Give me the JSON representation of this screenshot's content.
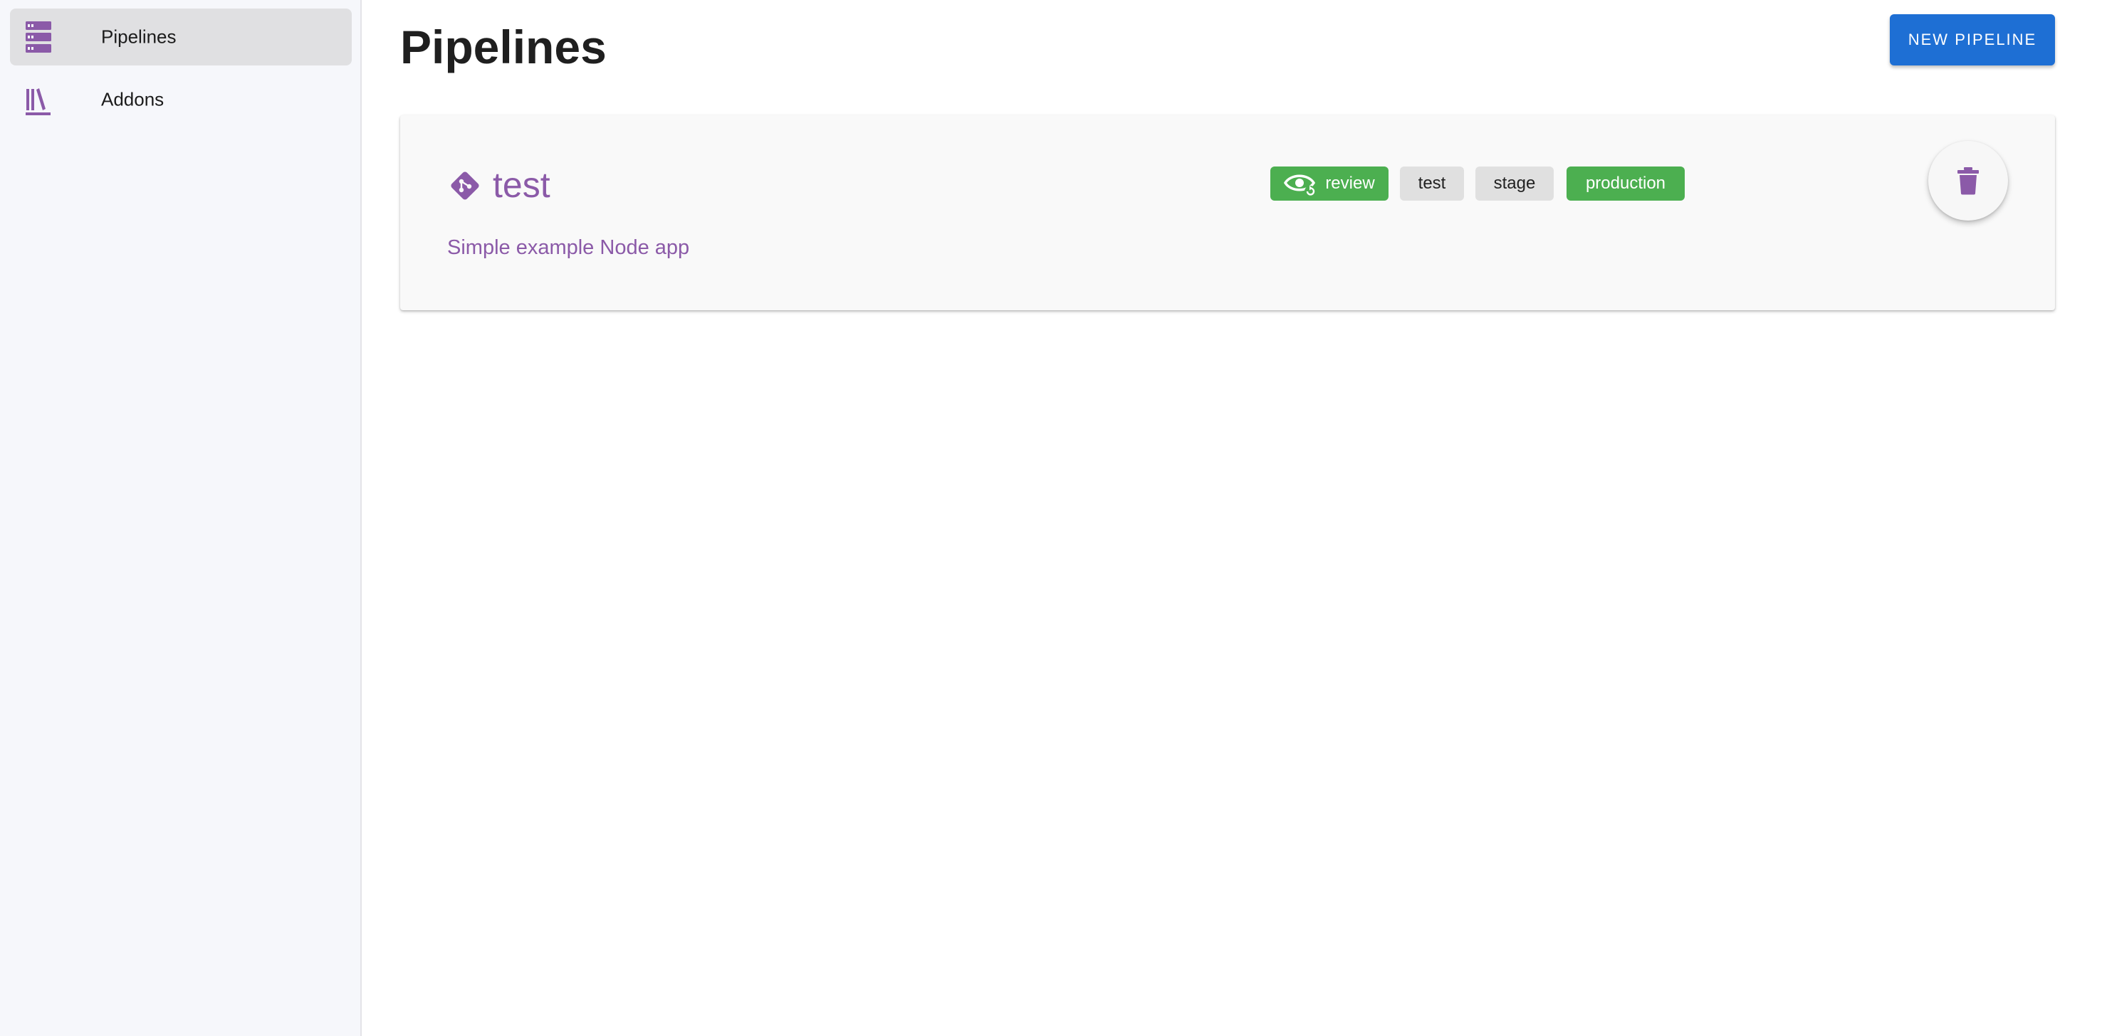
{
  "sidebar": {
    "items": [
      {
        "label": "Pipelines",
        "icon": "server-stack-icon",
        "active": true
      },
      {
        "label": "Addons",
        "icon": "library-books-icon",
        "active": false
      }
    ]
  },
  "header": {
    "title": "Pipelines",
    "new_pipeline_label": "NEW PIPELINE"
  },
  "pipelines": [
    {
      "name": "test",
      "description": "Simple example Node app",
      "icon": "git-icon",
      "phases": [
        {
          "label": "review",
          "enabled": true,
          "icon": "eye-refresh-icon"
        },
        {
          "label": "test",
          "enabled": false
        },
        {
          "label": "stage",
          "enabled": false
        },
        {
          "label": "production",
          "enabled": true
        }
      ],
      "delete_icon": "trash-icon"
    }
  ],
  "colors": {
    "accent_purple": "#8b5aa8",
    "primary_blue": "#1e6fd4",
    "phase_enabled_green": "#4caf50",
    "phase_disabled_gray": "#e0e0e0",
    "sidebar_bg": "#f6f7fb"
  }
}
